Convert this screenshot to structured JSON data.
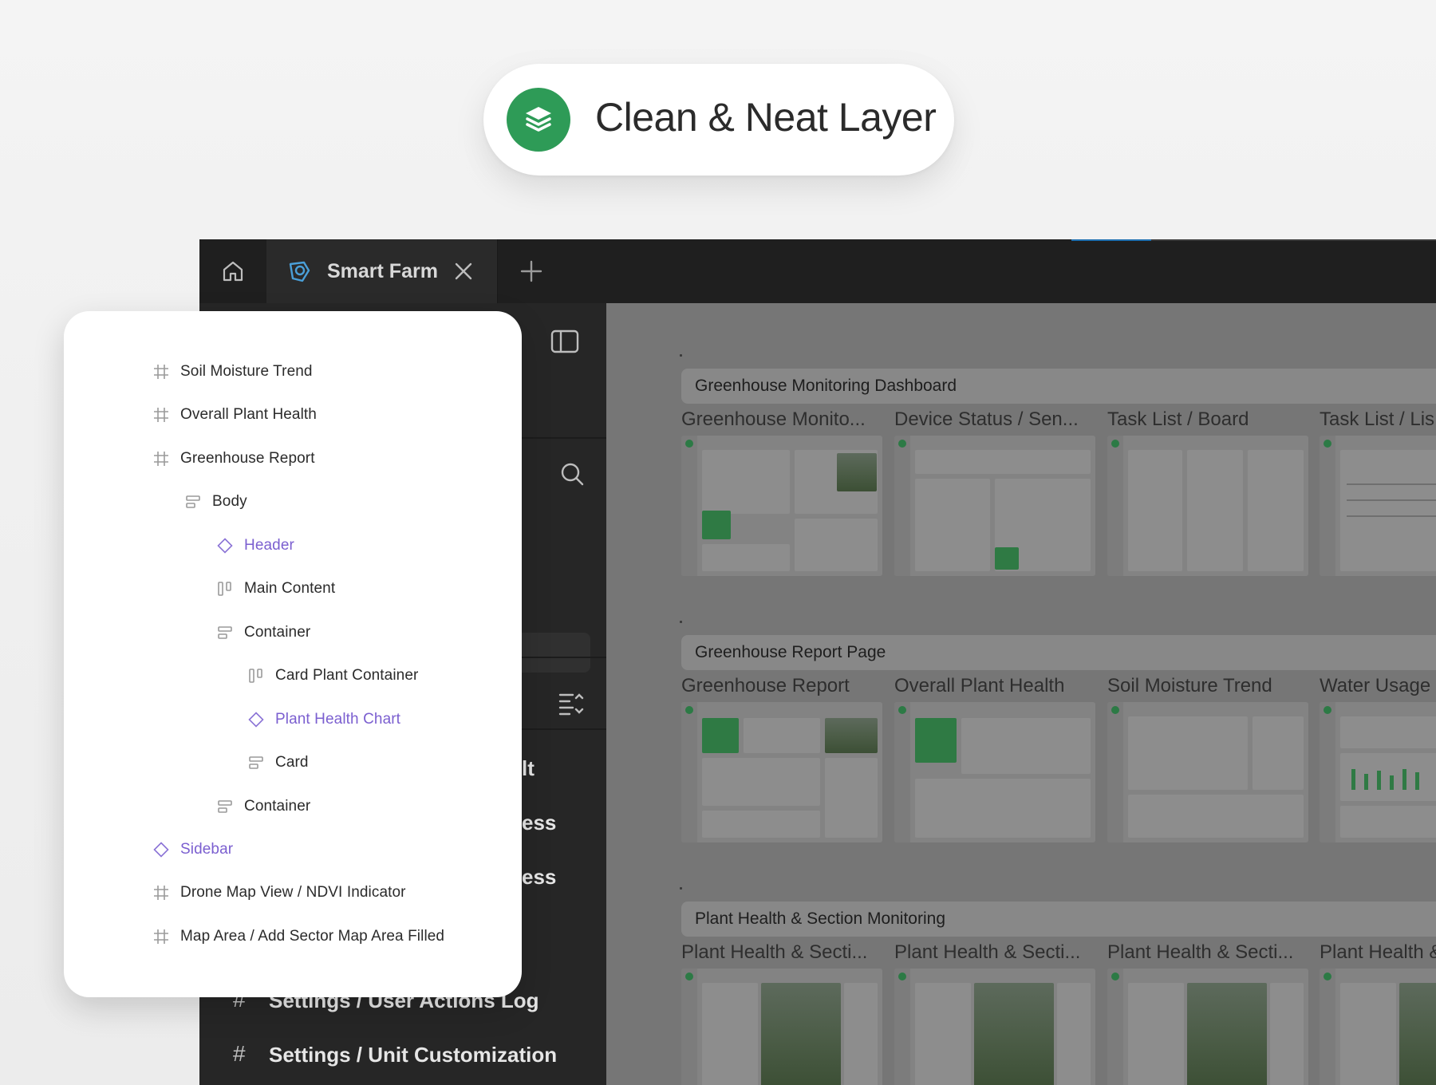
{
  "badge": {
    "icon": "layers-icon",
    "title": "Clean & Neat Layer"
  },
  "editor": {
    "tabs": {
      "home_icon": "home-icon",
      "file_tab_label": "Smart Farm",
      "file_tab_icon": "leaf-icon",
      "close_icon": "close-icon",
      "add_icon": "plus-icon"
    },
    "left_pane": {
      "panel_toggle_icon": "sidebar-icon",
      "search_icon": "search-icon",
      "collapse_icon": "collapse-list-icon",
      "partial_rows": [
        "lt",
        "ess",
        "ess"
      ],
      "pages": [
        "Settings / User Actions Log",
        "Settings / Unit Customization"
      ]
    },
    "canvas": {
      "sections": [
        {
          "title": "Greenhouse Monitoring Dashboard",
          "frames": [
            "Greenhouse Monito...",
            "Device Status / Sen...",
            "Task List / Board",
            "Task List / Lis"
          ]
        },
        {
          "title": "Greenhouse Report Page",
          "frames": [
            "Greenhouse Report",
            "Overall Plant Health",
            "Soil Moisture Trend",
            "Water Usage"
          ]
        },
        {
          "title": "Plant Health & Section Monitoring",
          "frames": [
            "Plant Health & Secti...",
            "Plant Health & Secti...",
            "Plant Health & Secti...",
            "Plant Health &"
          ]
        }
      ]
    }
  },
  "layers": {
    "items": [
      {
        "label": "Soil Moisture Trend",
        "type": "frame"
      },
      {
        "label": "Overall Plant Health",
        "type": "frame"
      },
      {
        "label": "Greenhouse Report",
        "type": "frame"
      },
      {
        "label": "Body",
        "type": "stack"
      },
      {
        "label": "Header",
        "type": "component"
      },
      {
        "label": "Main Content",
        "type": "columns"
      },
      {
        "label": "Container",
        "type": "stack"
      },
      {
        "label": "Card Plant Container",
        "type": "columns"
      },
      {
        "label": "Plant Health Chart",
        "type": "component"
      },
      {
        "label": "Card",
        "type": "stack"
      },
      {
        "label": "Container",
        "type": "stack"
      },
      {
        "label": "Sidebar",
        "type": "component"
      },
      {
        "label": "Drone Map View / NDVI Indicator",
        "type": "frame"
      },
      {
        "label": "Map Area / Add Sector Map Area Filled",
        "type": "frame"
      }
    ]
  },
  "colors": {
    "accent_green": "#2e9b57",
    "component_purple": "#7b5fd0",
    "editor_dark": "#262626",
    "canvas_gray": "#767676"
  }
}
